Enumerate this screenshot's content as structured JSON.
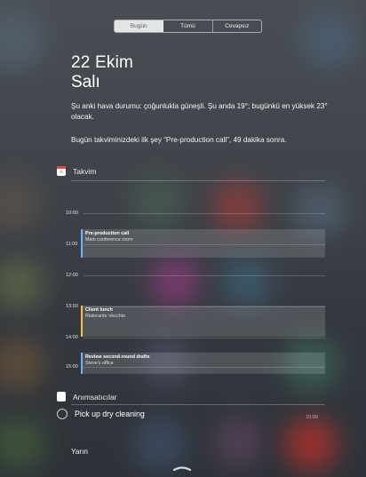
{
  "segments": [
    {
      "label": "Bugün",
      "active": true
    },
    {
      "label": "Tümü",
      "active": false
    },
    {
      "label": "Cevapsız",
      "active": false
    }
  ],
  "today": {
    "date": "22 Ekim",
    "weekday": "Salı",
    "weather": "Şu anki hava durumu: çoğunlukla güneşli. Şu anda 19°; bugünkü en yüksek 23° olacak.",
    "calendar_summary": "Bugün takviminizdeki ilk şey “Pre-production call”, 49 dakika sonra."
  },
  "calendar": {
    "title": "Takvim",
    "hours": [
      "10:00",
      "11:00",
      "12:00",
      "13:00",
      "14:00",
      "15:00"
    ],
    "events": [
      {
        "title": "Pre-production call",
        "location": "Main conference room"
      },
      {
        "title": "Client lunch",
        "location": "Ristorante Vecchio"
      },
      {
        "title": "Review second-round drafts",
        "location": "Steve's office"
      }
    ]
  },
  "reminders": {
    "title": "Anımsatıcılar",
    "items": [
      {
        "title": "Pick up dry cleaning",
        "time": "10:00"
      }
    ]
  },
  "tomorrow": {
    "title": "Yarın"
  },
  "colors": {
    "event_blue": "#6cb4ff",
    "event_orange": "#ffbf3f",
    "calendar_red": "#e8463f"
  },
  "icons": [
    "calendar-icon",
    "reminders-icon",
    "reminder-checkbox-icon",
    "grabber-handle-icon"
  ]
}
